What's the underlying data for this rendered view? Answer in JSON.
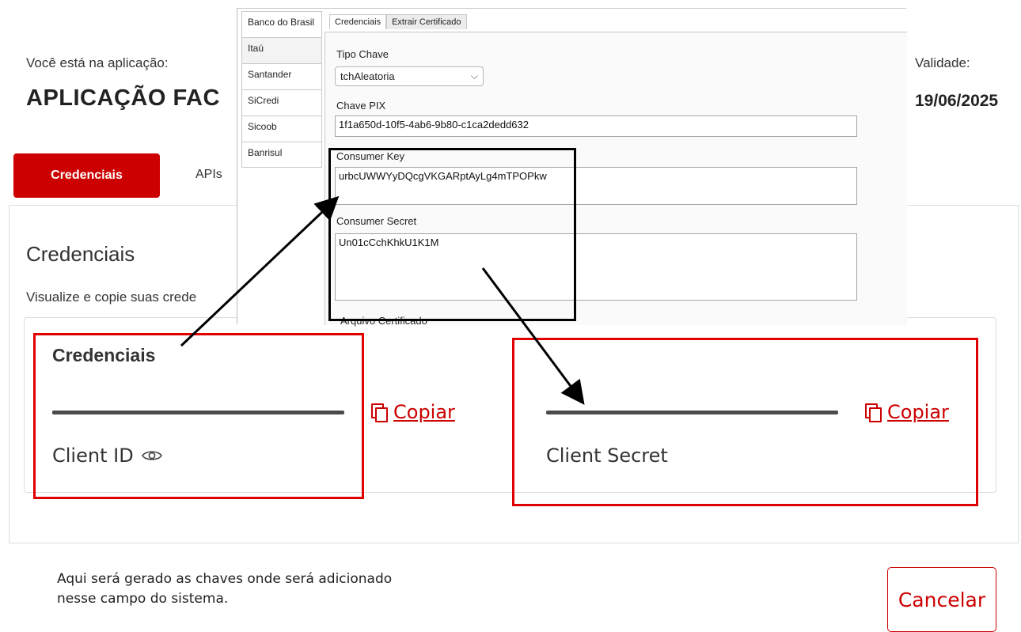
{
  "portal": {
    "app_caption": "Você está na aplicação:",
    "app_name": "APLICAÇÃO FAC",
    "validity_label": "Validade:",
    "validity_date": "19/06/2025",
    "tabs": [
      {
        "label": "Credenciais",
        "active": true
      },
      {
        "label": "APIs",
        "active": false
      }
    ],
    "section_title": "Credenciais",
    "section_subtitle": "Visualize e copie suas crede",
    "credentials_heading": "Credenciais",
    "client_id_label": "Client ID",
    "client_secret_label": "Client Secret",
    "copy_label": "Copiar",
    "cancel_label": "Cancelar",
    "accent_color": "#cc0000"
  },
  "annotation": {
    "note_line1": "Aqui será gerado as chaves onde será adicionado",
    "note_line2": "nesse campo do sistema.",
    "highlight_color": "#e00000"
  },
  "desktop_app": {
    "banks": [
      "Banco do Brasil",
      "Itaú",
      "Santander",
      "SiCredi",
      "Sicoob",
      "Banrisul"
    ],
    "active_bank_index": 1,
    "sub_tabs": [
      "Credenciais",
      "Extrair Certificado"
    ],
    "tipo_chave_label": "Tipo Chave",
    "tipo_chave_value": "tchAleatoria",
    "chave_pix_label": "Chave PIX",
    "chave_pix_value": "1f1a650d-10f5-4ab6-9b80-c1ca2dedd632",
    "consumer_key_label": "Consumer Key",
    "consumer_key_value": "urbcUWWYyDQcgVKGARptAyLg4mTPOPkw",
    "consumer_secret_label": "Consumer Secret",
    "consumer_secret_value": "Un01cCchKhkU1K1M",
    "arquivo_label": "Arquivo Certificado"
  }
}
